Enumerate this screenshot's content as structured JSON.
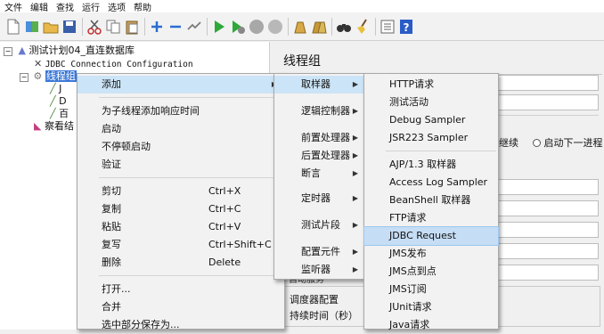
{
  "menubar": [
    "文件",
    "编辑",
    "查找",
    "运行",
    "选项",
    "帮助"
  ],
  "tree": {
    "root": "测试计划04_直连数据库",
    "child1": "JDBC Connection Configuration",
    "child2": "线程组",
    "leaf_a": "J",
    "leaf_b": "D",
    "leaf_c": "百",
    "child3": "察看结"
  },
  "right_panel": {
    "title": "线程组",
    "continue_text": "继续",
    "next_loop_text": "启动下一进程",
    "scheduler_label": "调度器配置",
    "duration_label": "持续时间（秒）",
    "partial_label": "自动服务"
  },
  "context_menu": {
    "items": [
      {
        "label": "添加",
        "shortcut": "",
        "arrow": "▶"
      },
      {
        "label": "为子线程添加响应时间",
        "shortcut": ""
      },
      {
        "label": "启动",
        "shortcut": ""
      },
      {
        "label": "不停顿启动",
        "shortcut": ""
      },
      {
        "label": "验证",
        "shortcut": ""
      },
      {
        "label": "剪切",
        "shortcut": "Ctrl+X"
      },
      {
        "label": "复制",
        "shortcut": "Ctrl+C"
      },
      {
        "label": "粘贴",
        "shortcut": "Ctrl+V"
      },
      {
        "label": "复写",
        "shortcut": "Ctrl+Shift+C"
      },
      {
        "label": "删除",
        "shortcut": "Delete"
      },
      {
        "label": "打开...",
        "shortcut": ""
      },
      {
        "label": "合并",
        "shortcut": ""
      },
      {
        "label": "选中部分保存为...",
        "shortcut": ""
      }
    ]
  },
  "add_submenu": {
    "items": [
      "取样器",
      "逻辑控制器",
      "前置处理器",
      "后置处理器",
      "断言",
      "定时器",
      "测试片段",
      "配置元件",
      "监听器"
    ],
    "arrow": "▶"
  },
  "sampler_submenu": {
    "items": [
      "HTTP请求",
      "测试活动",
      "Debug Sampler",
      "JSR223 Sampler",
      "AJP/1.3 取样器",
      "Access Log Sampler",
      "BeanShell 取样器",
      "FTP请求",
      "JDBC Request",
      "JMS发布",
      "JMS点到点",
      "JMS订阅",
      "JUnit请求",
      "Java请求"
    ],
    "highlighted": "JDBC Request"
  }
}
